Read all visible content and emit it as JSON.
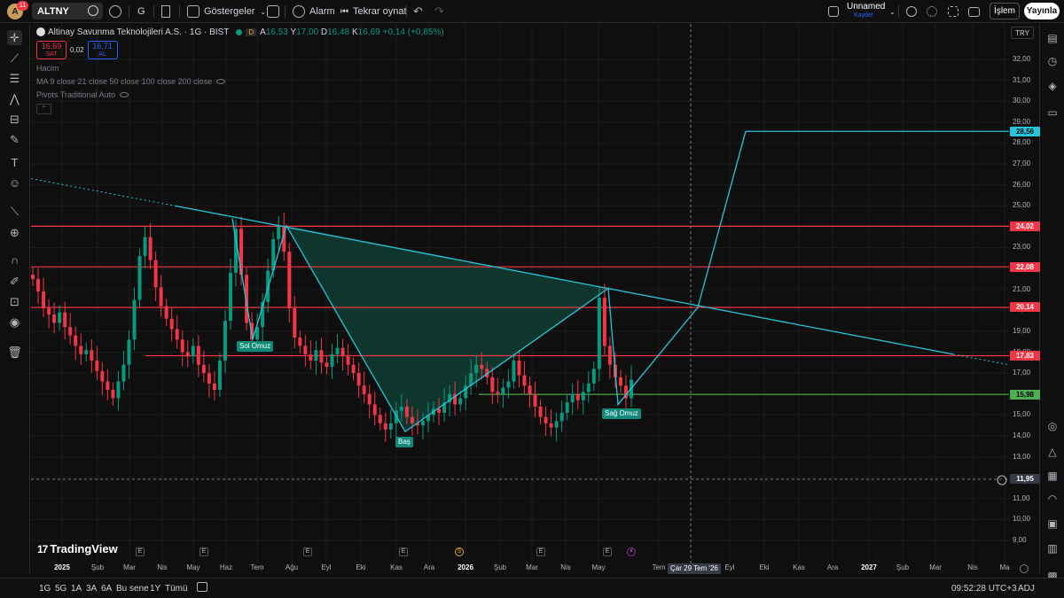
{
  "topbar": {
    "avatar_letter": "A",
    "avatar_badge": "11",
    "symbol": "ALTNY",
    "interval": "G",
    "indicators_label": "Göstergeler",
    "alarm_label": "Alarm",
    "replay_label": "Tekrar oynat",
    "layout_name": "Unnamed",
    "layout_status": "Kaydet",
    "trade_label": "İşlem",
    "publish_label": "Yayınla"
  },
  "legend": {
    "title": "Altinay Savunma Teknolojileri A.S. · 1G · BIST",
    "badge": "D",
    "ohlc": [
      {
        "k": "A",
        "v": "16,53"
      },
      {
        "k": "Y",
        "v": "17,00"
      },
      {
        "k": "D",
        "v": "16,48"
      },
      {
        "k": "K",
        "v": "16,69"
      }
    ],
    "change": "+0,14 (+0,85%)",
    "bid_price": "16,69",
    "bid_label": "SAT",
    "spread": "0,02",
    "ask_price": "16,71",
    "ask_label": "AL",
    "indicators": [
      "Hacim",
      "MA 9 close 21 close 50 close 100 close 200 close",
      "Pivots Traditional Auto"
    ]
  },
  "price_axis": {
    "currency": "TRY",
    "ticks": [
      "32,00",
      "31,00",
      "30,00",
      "29,00",
      "28,00",
      "27,00",
      "26,00",
      "25,00",
      "24,00",
      "23,00",
      "22,00",
      "21,00",
      "20,00",
      "19,00",
      "18,00",
      "17,00",
      "16,00",
      "15,00",
      "14,00",
      "13,00",
      "12,00",
      "11,00",
      "10,00",
      "9,00"
    ],
    "labels": [
      {
        "text": "28,56",
        "color": "#26c6da"
      },
      {
        "text": "24,02",
        "color": "#f23645"
      },
      {
        "text": "22,08",
        "color": "#f23645"
      },
      {
        "text": "20,14",
        "color": "#f23645"
      },
      {
        "text": "17,83",
        "color": "#f23645"
      },
      {
        "text": "15,98",
        "color": "#4caf50"
      },
      {
        "text": "11,95",
        "color": "#363a45"
      }
    ]
  },
  "time_axis": {
    "ticks": [
      "2025",
      "Şub",
      "Mar",
      "Nis",
      "May",
      "Haz",
      "Tem",
      "Ağu",
      "Eyl",
      "Eki",
      "Kas",
      "Ara",
      "2026",
      "Şub",
      "Mar",
      "Nis",
      "May",
      "Tem",
      "Eyl",
      "Eki",
      "Kas",
      "Ara",
      "2027",
      "Şub",
      "Mar",
      "Nis",
      "Ma"
    ],
    "crosshair_date": "Çar 29 Tem '26"
  },
  "pattern_labels": {
    "left_shoulder": "Sol Omuz",
    "head": "Baş",
    "right_shoulder": "Sağ Omuz"
  },
  "branding": "TradingView",
  "bottombar": {
    "ranges": [
      "1G",
      "5G",
      "1A",
      "3A",
      "6A",
      "Bu sene",
      "1Y",
      "Tümü"
    ],
    "clock": "09:52:28 UTC+3",
    "adj": "ADJ"
  },
  "colors": {
    "up": "#089981",
    "down": "#f23645",
    "trend": "#26c6da",
    "support": "#4caf50",
    "pattern_fill": "#0f3d33"
  },
  "chart_data": {
    "type": "candlestick",
    "ylim": [
      8.5,
      33.0
    ],
    "horizontal_levels": [
      28.56,
      24.02,
      22.08,
      20.14,
      17.83,
      15.98,
      11.95
    ],
    "head_and_shoulders": {
      "left_shoulder": 18.6,
      "head": 14.2,
      "right_shoulder": 15.5,
      "neckline_break": 20.14,
      "target": 28.56
    },
    "close_path": [
      21.5,
      20.9,
      20.1,
      19.8,
      19.4,
      19.9,
      19.2,
      18.8,
      18.3,
      17.9,
      18.1,
      17.6,
      17.1,
      16.6,
      16.2,
      15.8,
      16.6,
      17.4,
      18.6,
      20.5,
      22.6,
      23.5,
      22.4,
      21.1,
      20.2,
      19.6,
      19.1,
      18.6,
      18.0,
      17.8,
      18.3,
      17.4,
      17.0,
      16.5,
      16.2,
      17.6,
      19.5,
      21.8,
      23.9,
      21.7,
      19.4,
      18.6,
      19.2,
      20.4,
      21.9,
      23.4,
      24.0,
      22.8,
      20.1,
      18.7,
      18.3,
      17.9,
      17.6,
      18.1,
      17.5,
      17.3,
      17.9,
      18.2,
      17.8,
      17.4,
      17.0,
      16.4,
      16.0,
      15.5,
      15.0,
      14.6,
      14.3,
      14.6,
      15.2,
      15.4,
      14.9,
      14.6,
      14.5,
      14.7,
      15.0,
      15.3,
      15.1,
      15.6,
      16.0,
      15.5,
      15.8,
      16.4,
      17.0,
      17.4,
      17.2,
      16.8,
      16.1,
      16.0,
      16.3,
      16.6,
      17.6,
      16.9,
      16.4,
      16.0,
      15.4,
      14.9,
      14.6,
      14.4,
      14.7,
      15.1,
      15.6,
      16.0,
      15.7,
      16.1,
      16.5,
      17.2,
      20.6,
      18.3,
      17.4,
      16.8,
      16.4,
      15.8,
      16.69
    ]
  }
}
